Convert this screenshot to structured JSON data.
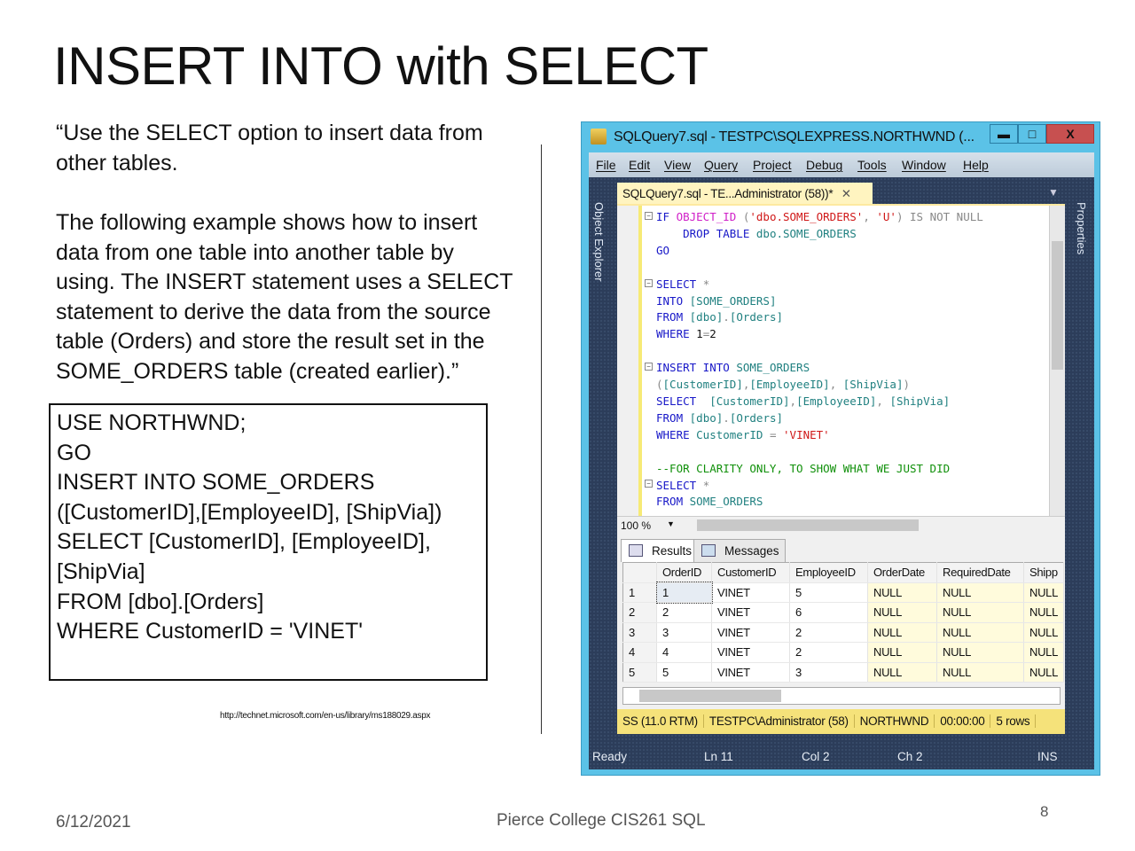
{
  "slide": {
    "title": "INSERT INTO with SELECT",
    "quote_lines": [
      "“Use the SELECT option to insert data from",
      "other tables."
    ],
    "para_lines": [
      "The following example shows how to insert",
      "data from one table into another table by",
      "using.  The INSERT statement uses a SELECT",
      "statement to derive the data from the source",
      "table (Orders) and store the result set in the",
      "SOME_ORDERS table (created earlier).”"
    ],
    "code_lines": [
      "USE NORTHWND;",
      "GO",
      "",
      "INSERT INTO SOME_ORDERS",
      "([CustomerID],[EmployeeID], [ShipVia])",
      "SELECT [CustomerID], [EmployeeID],",
      "[ShipVia]",
      "FROM [dbo].[Orders]",
      "WHERE CustomerID = 'VINET'"
    ],
    "source_url": "http://technet.microsoft.com/en-us/library/ms188029.aspx",
    "date": "6/12/2021",
    "footer": "Pierce College CIS261 SQL",
    "page_number": "8"
  },
  "ssms": {
    "window_title": "SQLQuery7.sql - TESTPC\\SQLEXPRESS.NORTHWND (...",
    "window_buttons": {
      "minimize": "▬",
      "maximize": "□",
      "close": "X"
    },
    "menu": [
      "File",
      "Edit",
      "View",
      "Query",
      "Project",
      "Debug",
      "Tools",
      "Window",
      "Help"
    ],
    "left_panel": "Object Explorer",
    "right_panel": "Properties",
    "doc_tab": "SQLQuery7.sql - TE...Administrator (58))*",
    "doc_tab_close": "✕",
    "code": [
      [
        [
          "IF ",
          "kw"
        ],
        [
          "OBJECT_ID",
          "fn"
        ],
        [
          " (",
          "gr"
        ],
        [
          "'dbo.SOME_ORDERS'",
          "str"
        ],
        [
          ", ",
          "gr"
        ],
        [
          "'U'",
          "str"
        ],
        [
          ") IS NOT NULL",
          "gr"
        ]
      ],
      [
        [
          "    DROP TABLE ",
          "kw"
        ],
        [
          "dbo.SOME_ORDERS",
          "tl"
        ]
      ],
      [
        [
          "GO",
          "kw"
        ]
      ],
      [],
      [
        [
          "SELECT ",
          "kw"
        ],
        [
          "*",
          "gr"
        ]
      ],
      [
        [
          "INTO ",
          "kw"
        ],
        [
          "[SOME_ORDERS]",
          "tl"
        ]
      ],
      [
        [
          "FROM ",
          "kw"
        ],
        [
          "[dbo]",
          "tl"
        ],
        [
          ".",
          "gr"
        ],
        [
          "[Orders]",
          "tl"
        ]
      ],
      [
        [
          "WHERE ",
          "kw"
        ],
        [
          "1",
          "bk"
        ],
        [
          "=",
          "gr"
        ],
        [
          "2",
          "bk"
        ]
      ],
      [],
      [
        [
          "INSERT INTO ",
          "kw"
        ],
        [
          "SOME_ORDERS",
          "tl"
        ]
      ],
      [
        [
          "(",
          "gr"
        ],
        [
          "[CustomerID]",
          "tl"
        ],
        [
          ",",
          "gr"
        ],
        [
          "[EmployeeID]",
          "tl"
        ],
        [
          ", ",
          "gr"
        ],
        [
          "[ShipVia]",
          "tl"
        ],
        [
          ")",
          "gr"
        ]
      ],
      [
        [
          "SELECT  ",
          "kw"
        ],
        [
          "[CustomerID]",
          "tl"
        ],
        [
          ",",
          "gr"
        ],
        [
          "[EmployeeID]",
          "tl"
        ],
        [
          ", ",
          "gr"
        ],
        [
          "[ShipVia]",
          "tl"
        ]
      ],
      [
        [
          "FROM ",
          "kw"
        ],
        [
          "[dbo]",
          "tl"
        ],
        [
          ".",
          "gr"
        ],
        [
          "[Orders]",
          "tl"
        ]
      ],
      [
        [
          "WHERE ",
          "kw"
        ],
        [
          "CustomerID ",
          "tl"
        ],
        [
          "= ",
          "gr"
        ],
        [
          "'VINET'",
          "str"
        ]
      ],
      [],
      [
        [
          "--FOR CLARITY ONLY, TO SHOW WHAT WE JUST DID",
          "cm"
        ]
      ],
      [
        [
          "SELECT ",
          "kw"
        ],
        [
          "*",
          "gr"
        ]
      ],
      [
        [
          "FROM ",
          "kw"
        ],
        [
          "SOME_ORDERS",
          "tl"
        ]
      ]
    ],
    "zoom": "100 %",
    "results_tab": "Results",
    "messages_tab": "Messages",
    "columns": [
      "",
      "OrderID",
      "CustomerID",
      "EmployeeID",
      "OrderDate",
      "RequiredDate",
      "Shipp"
    ],
    "rows": [
      [
        "1",
        "1",
        "VINET",
        "5",
        "NULL",
        "NULL",
        "NULL"
      ],
      [
        "2",
        "2",
        "VINET",
        "6",
        "NULL",
        "NULL",
        "NULL"
      ],
      [
        "3",
        "3",
        "VINET",
        "2",
        "NULL",
        "NULL",
        "NULL"
      ],
      [
        "4",
        "4",
        "VINET",
        "2",
        "NULL",
        "NULL",
        "NULL"
      ],
      [
        "5",
        "5",
        "VINET",
        "3",
        "NULL",
        "NULL",
        "NULL"
      ]
    ],
    "query_status": [
      "SS (11.0 RTM)",
      "TESTPC\\Administrator (58)",
      "NORTHWND",
      "00:00:00",
      "5 rows"
    ],
    "status": {
      "ready": "Ready",
      "ln": "Ln 11",
      "col": "Col 2",
      "ch": "Ch 2",
      "ins": "INS"
    },
    "colors": {
      "window_border": "#5bc2e7",
      "body": "#2c3d5a",
      "status_yellow": "#f5e27a",
      "keyword": "#1818c8",
      "string": "#d01818",
      "comment": "#10900a"
    }
  }
}
